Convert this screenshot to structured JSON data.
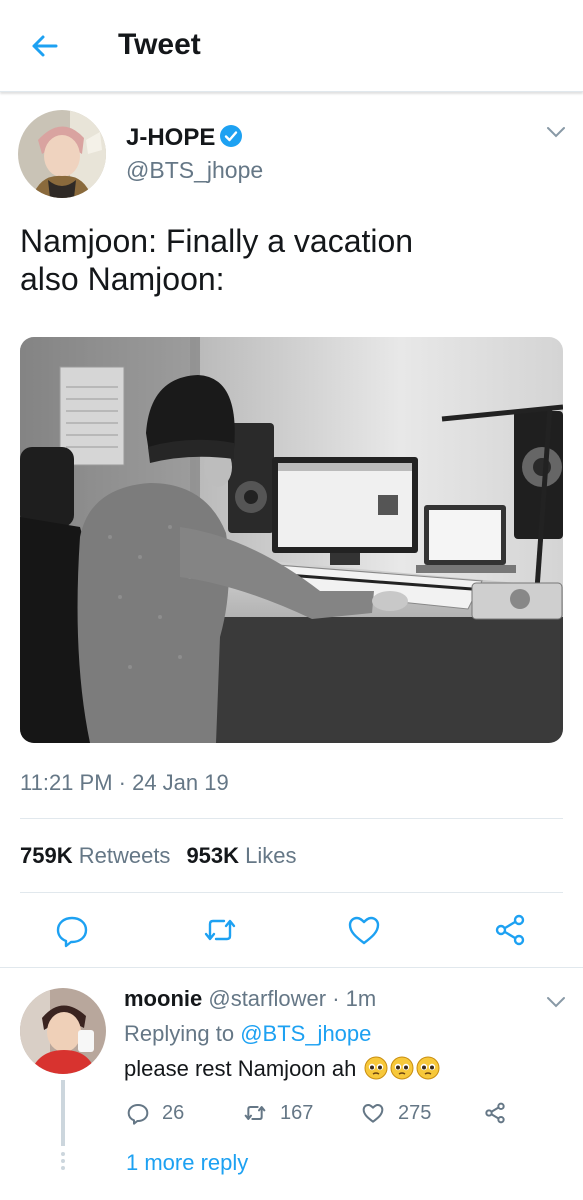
{
  "header": {
    "title": "Tweet",
    "back_icon": "arrow-left-icon"
  },
  "colors": {
    "accent": "#1da1f2",
    "text": "#14171a",
    "secondary": "#657786",
    "divider": "#e1e8ed"
  },
  "tweet": {
    "author_name": "J-HOPE",
    "author_handle": "@BTS_jhope",
    "verified": true,
    "text": "Namjoon: Finally a vacation\nalso Namjoon:",
    "timestamp": "11:21 PM · 24 Jan 19",
    "retweets_count": "759K",
    "retweets_label": "Retweets",
    "likes_count": "953K",
    "likes_label": "Likes",
    "actions": [
      "reply-icon",
      "retweet-icon",
      "like-icon",
      "share-icon"
    ]
  },
  "reply": {
    "author_name": "moonie",
    "author_handle": "@starflower",
    "separator": "·",
    "time": "1m",
    "replying_to_label": "Replying to",
    "replying_to_handle": "@BTS_jhope",
    "text": "please rest Namjoon ah",
    "reply_count": "26",
    "retweet_count": "167",
    "like_count": "275",
    "more_replies_label": "1 more reply"
  }
}
